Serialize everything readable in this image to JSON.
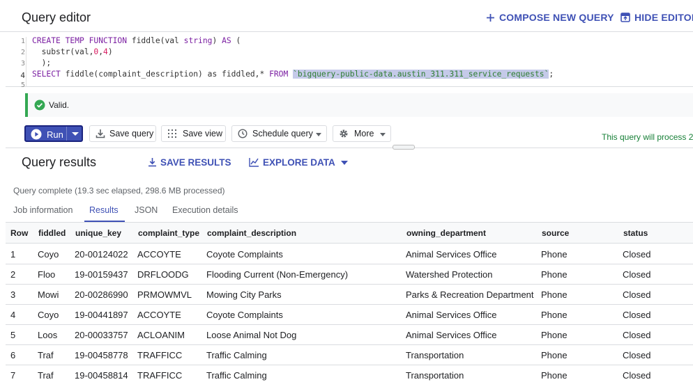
{
  "header": {
    "title": "Query editor",
    "compose_label": "COMPOSE NEW QUERY",
    "hide_label": "HIDE EDITOR"
  },
  "editor": {
    "line_numbers": [
      "1",
      "2",
      "3",
      "4",
      "5"
    ],
    "lines": [
      "CREATE TEMP FUNCTION fiddle(val string) AS (",
      "  substr(val,0,4)",
      "  );",
      " SELECT fiddle(complaint_description) as fiddled,* FROM `bigquery-public-data.austin_311.311_service_requests`;"
    ],
    "line1": {
      "kw1": "CREATE TEMP FUNCTION",
      "mid": " fiddle(val ",
      "kw2": "string",
      "end": ") ",
      "kw3": "AS",
      "tail": " ("
    },
    "line2": {
      "pre": "  substr(val,",
      "n1": "0",
      "c": ",",
      "n2": "4",
      "post": ")"
    },
    "line3": "  );",
    "line4": {
      "kw1": "SELECT",
      "mid": " fiddle(complaint_description) as fiddled,* ",
      "kw2": "FROM",
      "sp": " ",
      "table": "`bigquery-public-data.austin_311.311_service_requests`",
      "end": ";"
    }
  },
  "validation": {
    "text": "Valid."
  },
  "toolbar": {
    "run_label": "Run",
    "save_query_label": "Save query",
    "save_view_label": "Save view",
    "schedule_label": "Schedule query",
    "more_label": "More",
    "process_text": "This query will process 2"
  },
  "results": {
    "title": "Query results",
    "save_results_label": "SAVE RESULTS",
    "explore_label": "EXPLORE DATA",
    "status": "Query complete (19.3 sec elapsed, 298.6 MB processed)",
    "tabs": [
      "Job information",
      "Results",
      "JSON",
      "Execution details"
    ],
    "active_tab": "Results"
  },
  "table": {
    "columns": [
      "Row",
      "fiddled",
      "unique_key",
      "complaint_type",
      "complaint_description",
      "owning_department",
      "source",
      "status"
    ],
    "rows": [
      [
        "1",
        "Coyo",
        "20-00124022",
        "ACCOYTE",
        "Coyote Complaints",
        "Animal Services Office",
        "Phone",
        "Closed"
      ],
      [
        "2",
        "Floo",
        "19-00159437",
        "DRFLOODG",
        "Flooding  Current (Non-Emergency)",
        "Watershed Protection",
        "Phone",
        "Closed"
      ],
      [
        "3",
        "Mowi",
        "20-00286990",
        "PRMOWMVL",
        "Mowing City Parks",
        "Parks & Recreation Department",
        "Phone",
        "Closed"
      ],
      [
        "4",
        "Coyo",
        "19-00441897",
        "ACCOYTE",
        "Coyote Complaints",
        "Animal Services Office",
        "Phone",
        "Closed"
      ],
      [
        "5",
        "Loos",
        "20-00033757",
        "ACLOANIM",
        "Loose Animal Not Dog",
        "Animal Services Office",
        "Phone",
        "Closed"
      ],
      [
        "6",
        "Traf",
        "19-00458778",
        "TRAFFICC",
        "Traffic Calming",
        "Transportation",
        "Phone",
        "Closed"
      ],
      [
        "7",
        "Traf",
        "19-00458814",
        "TRAFFICC",
        "Traffic Calming",
        "Transportation",
        "Phone",
        "Closed"
      ]
    ]
  },
  "colors": {
    "accent": "#3f51b5",
    "valid": "#34a853",
    "process": "#188038"
  }
}
